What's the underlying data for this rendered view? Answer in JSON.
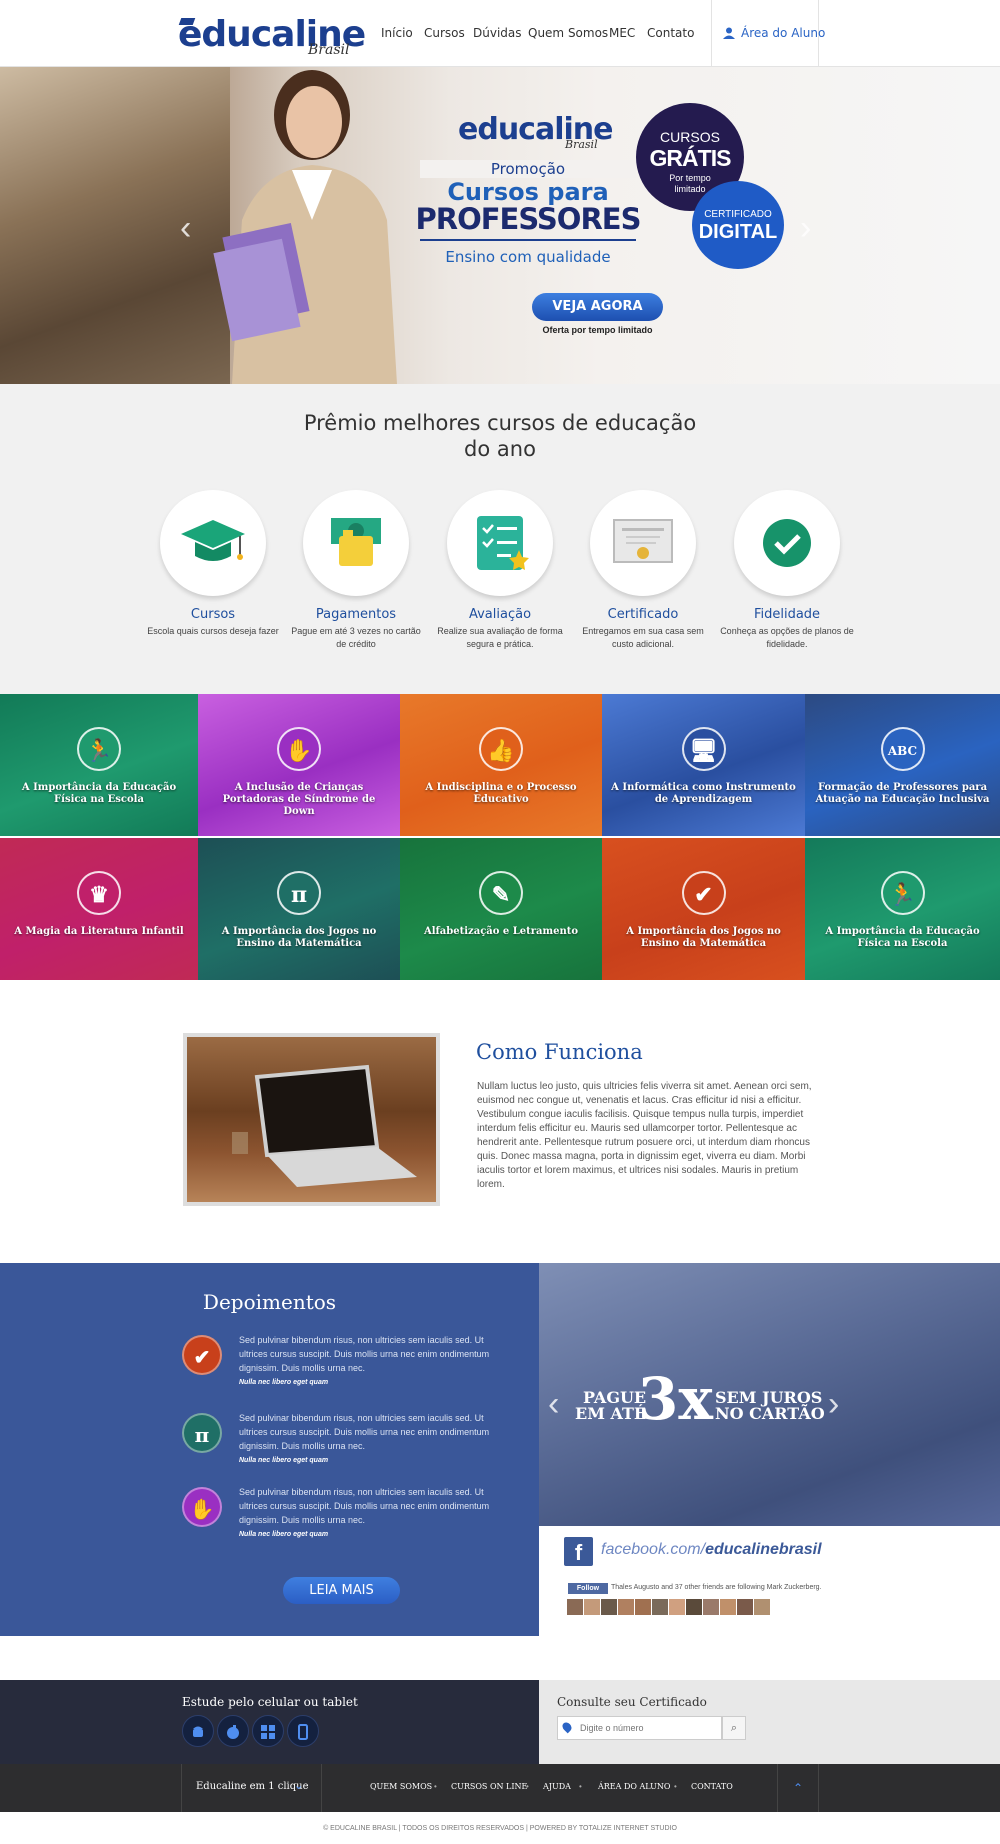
{
  "header": {
    "logo_text": "educaline",
    "logo_sub": "Brasil",
    "nav": [
      "Início",
      "Cursos",
      "Dúvidas",
      "Quem Somos",
      "MEC",
      "Contato"
    ],
    "aluno": "Área do Aluno"
  },
  "hero": {
    "logo_text": "educaline",
    "logo_sub": "Brasil",
    "promo": "Promoção",
    "cursos_para": "Cursos para",
    "professores": "PROFESSORES",
    "ensino": "Ensino com qualidade",
    "badge1": {
      "l1": "CURSOS",
      "l2": "GRÁTIS",
      "l3": "Por tempo limitado"
    },
    "badge2": {
      "l1": "CERTIFICADO",
      "l2": "DIGITAL"
    },
    "cta": "VEJA AGORA",
    "oferta": "Oferta por tempo limitado"
  },
  "awards": {
    "title": "Prêmio melhores cursos de educação do ano",
    "items": [
      {
        "title": "Cursos",
        "desc": "Escola quais cursos deseja fazer",
        "icon": "graduation-cap-icon"
      },
      {
        "title": "Pagamentos",
        "desc": "Pague em até 3 vezes no cartão de crédito",
        "icon": "money-icon"
      },
      {
        "title": "Avaliação",
        "desc": "Realize sua avaliação de forma segura e prática.",
        "icon": "checklist-icon"
      },
      {
        "title": "Certificado",
        "desc": "Entregamos em sua casa sem custo adicional.",
        "icon": "certificate-icon"
      },
      {
        "title": "Fidelidade",
        "desc": "Conheça as opções de planos de fidelidade.",
        "icon": "check-badge-icon"
      }
    ]
  },
  "tiles": [
    {
      "label": "A Importância da Educação Física na Escola",
      "glyph": "🏃",
      "color": "#1f9a6e",
      "bg": "#127a57"
    },
    {
      "label": "A Inclusão de Crianças Portadoras de Síndrome de Down",
      "glyph": "✋",
      "color": "#9a2fc2",
      "bg": "#c960e0"
    },
    {
      "label": "A Indisciplina e o Processo Educativo",
      "glyph": "👍",
      "color": "#e0601b",
      "bg": "#e8792a"
    },
    {
      "label": "A Informática como Instrumento de Aprendizagem",
      "glyph": "🖥",
      "color": "#2a4fa0",
      "bg": "#4c7ad4"
    },
    {
      "label": "Formação de Professores para Atuação na Educação Inclusiva",
      "glyph": "ABC",
      "color": "#2a63c0",
      "bg": "#2c4a82"
    },
    {
      "label": "A Magia da Literatura Infantil",
      "glyph": "♛",
      "color": "#c0206a",
      "bg": "#c02a55"
    },
    {
      "label": "A Importância dos Jogos no Ensino da Matemática",
      "glyph": "π",
      "color": "#1f6f66",
      "bg": "#1d4f55"
    },
    {
      "label": "Alfabetização e Letramento",
      "glyph": "✎",
      "color": "#1d8a4a",
      "bg": "#17733c"
    },
    {
      "label": "A Importância dos Jogos no Ensino da Matemática",
      "glyph": "✔",
      "color": "#c8401b",
      "bg": "#d8501f"
    },
    {
      "label": "A Importância da Educação Física na Escola",
      "glyph": "🏃",
      "color": "#1f9a6e",
      "bg": "#147a5a"
    }
  ],
  "como": {
    "title": "Como Funciona",
    "text": "Nullam luctus leo justo, quis ultricies felis viverra sit amet. Aenean orci sem, euismod nec congue ut, venenatis et lacus. Cras efficitur id nisi a efficitur. Vestibulum congue iaculis facilisis. Quisque tempus nulla turpis, imperdiet interdum felis efficitur eu. Mauris sed ullamcorper tortor. Pellentesque ac hendrerit ante. Pellentesque rutrum posuere orci, ut interdum diam rhoncus quis. Donec massa magna, porta in dignissim eget, viverra eu diam. Morbi iaculis tortor et lorem maximus, et ultrices nisi sodales. Mauris in pretium lorem."
  },
  "depoimentos": {
    "title": "Depoimentos",
    "items": [
      {
        "text": "Sed pulvinar bibendum risus, non ultricies sem iaculis sed. Ut ultrices cursus suscipit. Duis mollis urna nec enim ondimentum dignissim. Duis mollis urna nec.",
        "author": "Nulla nec libero eget quam",
        "glyph": "✔",
        "color": "#c8401b"
      },
      {
        "text": "Sed pulvinar bibendum risus, non ultricies sem iaculis sed. Ut ultrices cursus suscipit. Duis mollis urna nec enim ondimentum dignissim. Duis mollis urna nec.",
        "author": "Nulla nec libero eget quam",
        "glyph": "π",
        "color": "#1f6f66"
      },
      {
        "text": "Sed pulvinar bibendum risus, non ultricies sem iaculis sed. Ut ultrices cursus suscipit. Duis mollis urna nec enim ondimentum dignissim. Duis mollis urna nec.",
        "author": "Nulla nec libero eget quam",
        "glyph": "✋",
        "color": "#9a2fc2"
      }
    ],
    "button": "LEIA MAIS"
  },
  "pay": {
    "l1": "PAGUE",
    "l2": "EM ATÉ",
    "big": "3x",
    "r1": "SEM JUROS",
    "r2": "NO CARTÃO"
  },
  "facebook": {
    "url_prefix": "facebook.com/",
    "url_name": "educalinebrasil",
    "follow": "Follow",
    "follow_text": "Thales Augusto and 37 other friends are following Mark Zuckerberg."
  },
  "footer": {
    "estude": "Estude pelo celular ou tablet",
    "apps": [
      "android-icon",
      "apple-icon",
      "windows-icon",
      "phone-icon"
    ],
    "consulte": "Consulte seu Certificado",
    "placeholder": "Digite o número",
    "umclique": "Educaline em 1 clique",
    "links": [
      "QUEM SOMOS",
      "CURSOS ON LINE",
      "AJUDA",
      "ÁREA DO ALUNO",
      "CONTATO"
    ],
    "copyright": "© EDUCALINE BRASIL | TODOS OS DIREITOS RESERVADOS | POWERED BY TOTALIZE INTERNET STUDIO"
  }
}
